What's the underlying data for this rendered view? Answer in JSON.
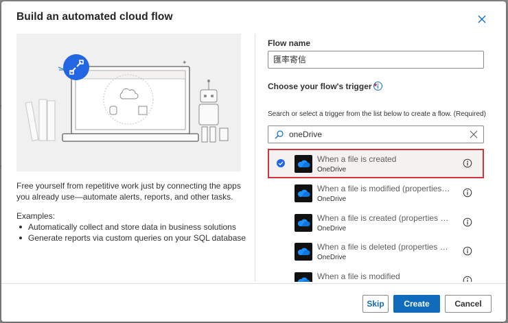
{
  "dialog": {
    "title": "Build an automated cloud flow"
  },
  "left": {
    "description": "Free yourself from repetitive work just by connecting the apps you already use—automate alerts, reports, and other tasks.",
    "examples_heading": "Examples:",
    "examples": [
      "Automatically collect and store data in business solutions",
      "Generate reports via custom queries on your SQL database"
    ]
  },
  "form": {
    "flow_name_label": "Flow name",
    "flow_name_value": "匯率寄信",
    "trigger_label": "Choose your flow's trigger",
    "required_marker": "*",
    "helper_text": "Search or select a trigger from the list below to create a flow. (Required)",
    "search_value": "oneDrive"
  },
  "triggers": [
    {
      "title": "When a file is created",
      "connector": "OneDrive",
      "selected": true
    },
    {
      "title": "When a file is modified (properties o...",
      "connector": "OneDrive",
      "selected": false
    },
    {
      "title": "When a file is created (properties only)",
      "connector": "OneDrive",
      "selected": false
    },
    {
      "title": "When a file is deleted (properties onl...",
      "connector": "OneDrive",
      "selected": false
    },
    {
      "title": "When a file is modified",
      "connector": "OneDrive",
      "selected": false
    }
  ],
  "footer": {
    "skip_label": "Skip",
    "create_label": "Create",
    "cancel_label": "Cancel"
  },
  "icons": {
    "close": "close-icon",
    "info": "info-icon",
    "search": "search-icon",
    "clear": "clear-icon",
    "check": "checkmark-circle-icon",
    "connector": "onedrive-cloud-icon",
    "flow": "flow-icon"
  },
  "colors": {
    "accent": "#0f6cbd",
    "selected_border": "#d13438",
    "required": "#a4262c"
  }
}
